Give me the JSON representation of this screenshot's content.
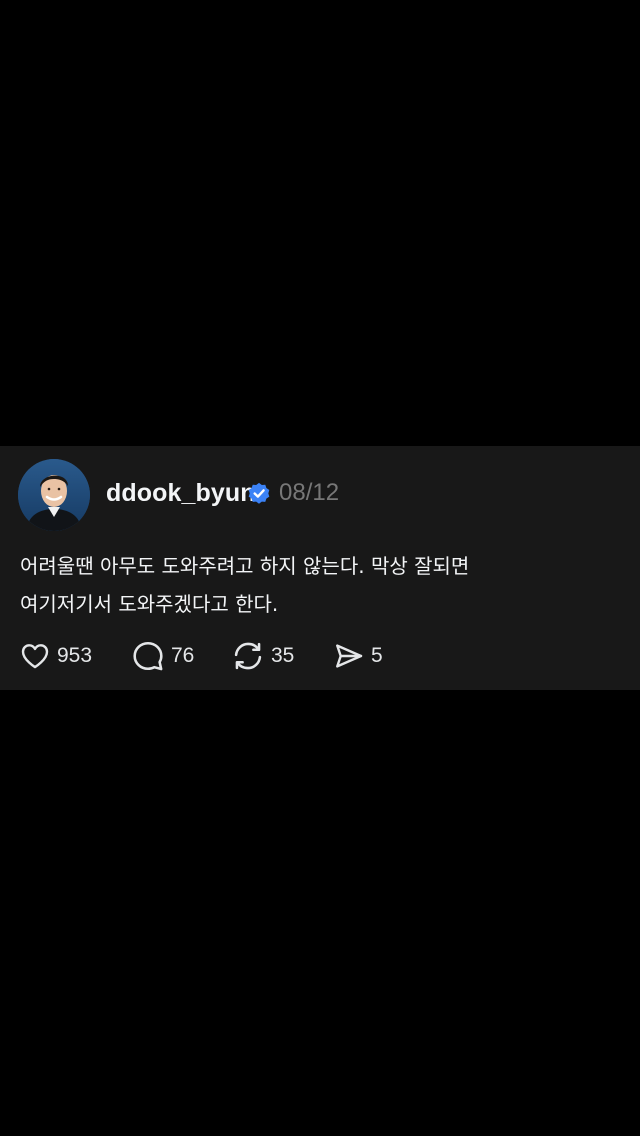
{
  "post": {
    "username": "ddook_byun",
    "verified": true,
    "date": "08/12",
    "text_lines": [
      "어려울땐 아무도 도와주려고 하지 않는다. 막상 잘되면",
      "여기저기서 도와주겠다고 한다."
    ],
    "actions": {
      "likes": "953",
      "comments": "76",
      "reposts": "35",
      "shares": "5"
    }
  },
  "theme": {
    "background": "#000000",
    "card_background": "#181818",
    "text_color": "#f3f5f7",
    "muted_text_color": "#777777",
    "verified_color": "#3b82f6"
  },
  "icons": {
    "like": "heart-icon",
    "comment": "speech-bubble-icon",
    "repost": "repost-arrows-icon",
    "share": "paper-plane-icon",
    "verified": "verified-badge-icon"
  }
}
